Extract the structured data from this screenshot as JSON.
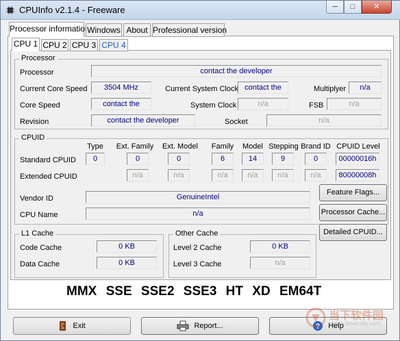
{
  "window": {
    "title": "CPUInfo v2.1.4 - Freeware",
    "min_glyph": "─",
    "max_glyph": "□",
    "close_glyph": "✕"
  },
  "main_tabs": [
    {
      "label": "Processor information"
    },
    {
      "label": "Windows"
    },
    {
      "label": "About"
    },
    {
      "label": "Professional version"
    }
  ],
  "cpu_tabs": [
    {
      "label": "CPU 1"
    },
    {
      "label": "CPU 2"
    },
    {
      "label": "CPU 3"
    },
    {
      "label": "CPU 4"
    }
  ],
  "processor": {
    "group_title": "Processor",
    "processor_label": "Processor",
    "processor_value": "contact the developer",
    "current_core_speed_label": "Current Core Speed",
    "current_core_speed_value": "3504 MHz",
    "current_system_clock_label": "Current System Clock",
    "current_system_clock_value": "contact the",
    "multiplyer_label": "Multiplyer",
    "multiplyer_value": "n/a",
    "core_speed_label": "Core Speed",
    "core_speed_value": "contact the",
    "system_clock_label": "System Clock",
    "system_clock_value": "n/a",
    "fsb_label": "FSB",
    "fsb_value": "n/a",
    "revision_label": "Revision",
    "revision_value": "contact the developer",
    "socket_label": "Socket",
    "socket_value": "n/a"
  },
  "cpuid": {
    "group_title": "CPUID",
    "col_type": "Type",
    "col_ext_family": "Ext. Family",
    "col_ext_model": "Ext. Model",
    "col_family": "Family",
    "col_model": "Model",
    "col_stepping": "Stepping",
    "col_brand_id": "Brand ID",
    "col_cpuid_level": "CPUID Level",
    "standard_label": "Standard CPUID",
    "standard": {
      "type": "0",
      "ext_family": "0",
      "ext_model": "0",
      "family": "6",
      "model": "14",
      "stepping": "9",
      "brand_id": "0",
      "cpuid_level": "00000016h"
    },
    "extended_label": "Extended CPUID",
    "extended": {
      "ext_family": "n/a",
      "ext_model": "n/a",
      "family": "n/a",
      "model": "n/a",
      "stepping": "n/a",
      "brand_id": "n/a",
      "cpuid_level": "80000008h"
    },
    "vendor_id_label": "Vendor ID",
    "vendor_id_value": "GenuineIntel",
    "cpu_name_label": "CPU Name",
    "cpu_name_value": "n/a"
  },
  "side_buttons": {
    "feature_flags": "Feature Flags...",
    "processor_cache": "Processor Cache...",
    "detailed_cpuid": "Detailed CPUID..."
  },
  "l1_cache": {
    "group_title": "L1 Cache",
    "code_cache_label": "Code Cache",
    "code_cache_value": "0 KB",
    "data_cache_label": "Data Cache",
    "data_cache_value": "0 KB"
  },
  "other_cache": {
    "group_title": "Other Cache",
    "level2_label": "Level 2 Cache",
    "level2_value": "0 KB",
    "level3_label": "Level 3 Cache",
    "level3_value": "n/a"
  },
  "features": [
    "MMX",
    "SSE",
    "SSE2",
    "SSE3",
    "HT",
    "XD",
    "EM64T"
  ],
  "bottom_buttons": {
    "exit": "Exit",
    "report": "Report...",
    "help": "Help"
  },
  "watermark": {
    "text": "当下软件园",
    "url": "www.downxia.com"
  }
}
